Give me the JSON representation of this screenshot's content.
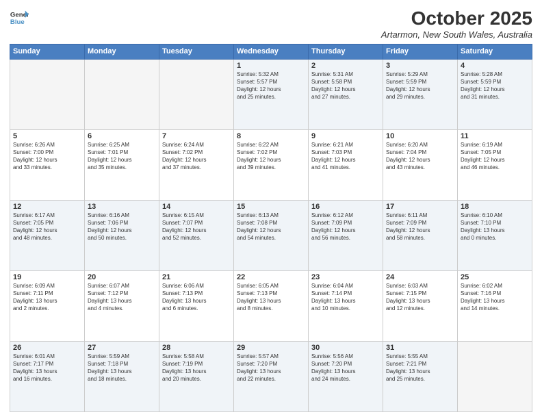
{
  "logo": {
    "line1": "General",
    "line2": "Blue"
  },
  "title": "October 2025",
  "location": "Artarmon, New South Wales, Australia",
  "days_of_week": [
    "Sunday",
    "Monday",
    "Tuesday",
    "Wednesday",
    "Thursday",
    "Friday",
    "Saturday"
  ],
  "weeks": [
    [
      {
        "day": "",
        "info": ""
      },
      {
        "day": "",
        "info": ""
      },
      {
        "day": "",
        "info": ""
      },
      {
        "day": "1",
        "info": "Sunrise: 5:32 AM\nSunset: 5:57 PM\nDaylight: 12 hours\nand 25 minutes."
      },
      {
        "day": "2",
        "info": "Sunrise: 5:31 AM\nSunset: 5:58 PM\nDaylight: 12 hours\nand 27 minutes."
      },
      {
        "day": "3",
        "info": "Sunrise: 5:29 AM\nSunset: 5:59 PM\nDaylight: 12 hours\nand 29 minutes."
      },
      {
        "day": "4",
        "info": "Sunrise: 5:28 AM\nSunset: 5:59 PM\nDaylight: 12 hours\nand 31 minutes."
      }
    ],
    [
      {
        "day": "5",
        "info": "Sunrise: 6:26 AM\nSunset: 7:00 PM\nDaylight: 12 hours\nand 33 minutes."
      },
      {
        "day": "6",
        "info": "Sunrise: 6:25 AM\nSunset: 7:01 PM\nDaylight: 12 hours\nand 35 minutes."
      },
      {
        "day": "7",
        "info": "Sunrise: 6:24 AM\nSunset: 7:02 PM\nDaylight: 12 hours\nand 37 minutes."
      },
      {
        "day": "8",
        "info": "Sunrise: 6:22 AM\nSunset: 7:02 PM\nDaylight: 12 hours\nand 39 minutes."
      },
      {
        "day": "9",
        "info": "Sunrise: 6:21 AM\nSunset: 7:03 PM\nDaylight: 12 hours\nand 41 minutes."
      },
      {
        "day": "10",
        "info": "Sunrise: 6:20 AM\nSunset: 7:04 PM\nDaylight: 12 hours\nand 43 minutes."
      },
      {
        "day": "11",
        "info": "Sunrise: 6:19 AM\nSunset: 7:05 PM\nDaylight: 12 hours\nand 46 minutes."
      }
    ],
    [
      {
        "day": "12",
        "info": "Sunrise: 6:17 AM\nSunset: 7:05 PM\nDaylight: 12 hours\nand 48 minutes."
      },
      {
        "day": "13",
        "info": "Sunrise: 6:16 AM\nSunset: 7:06 PM\nDaylight: 12 hours\nand 50 minutes."
      },
      {
        "day": "14",
        "info": "Sunrise: 6:15 AM\nSunset: 7:07 PM\nDaylight: 12 hours\nand 52 minutes."
      },
      {
        "day": "15",
        "info": "Sunrise: 6:13 AM\nSunset: 7:08 PM\nDaylight: 12 hours\nand 54 minutes."
      },
      {
        "day": "16",
        "info": "Sunrise: 6:12 AM\nSunset: 7:09 PM\nDaylight: 12 hours\nand 56 minutes."
      },
      {
        "day": "17",
        "info": "Sunrise: 6:11 AM\nSunset: 7:09 PM\nDaylight: 12 hours\nand 58 minutes."
      },
      {
        "day": "18",
        "info": "Sunrise: 6:10 AM\nSunset: 7:10 PM\nDaylight: 13 hours\nand 0 minutes."
      }
    ],
    [
      {
        "day": "19",
        "info": "Sunrise: 6:09 AM\nSunset: 7:11 PM\nDaylight: 13 hours\nand 2 minutes."
      },
      {
        "day": "20",
        "info": "Sunrise: 6:07 AM\nSunset: 7:12 PM\nDaylight: 13 hours\nand 4 minutes."
      },
      {
        "day": "21",
        "info": "Sunrise: 6:06 AM\nSunset: 7:13 PM\nDaylight: 13 hours\nand 6 minutes."
      },
      {
        "day": "22",
        "info": "Sunrise: 6:05 AM\nSunset: 7:13 PM\nDaylight: 13 hours\nand 8 minutes."
      },
      {
        "day": "23",
        "info": "Sunrise: 6:04 AM\nSunset: 7:14 PM\nDaylight: 13 hours\nand 10 minutes."
      },
      {
        "day": "24",
        "info": "Sunrise: 6:03 AM\nSunset: 7:15 PM\nDaylight: 13 hours\nand 12 minutes."
      },
      {
        "day": "25",
        "info": "Sunrise: 6:02 AM\nSunset: 7:16 PM\nDaylight: 13 hours\nand 14 minutes."
      }
    ],
    [
      {
        "day": "26",
        "info": "Sunrise: 6:01 AM\nSunset: 7:17 PM\nDaylight: 13 hours\nand 16 minutes."
      },
      {
        "day": "27",
        "info": "Sunrise: 5:59 AM\nSunset: 7:18 PM\nDaylight: 13 hours\nand 18 minutes."
      },
      {
        "day": "28",
        "info": "Sunrise: 5:58 AM\nSunset: 7:19 PM\nDaylight: 13 hours\nand 20 minutes."
      },
      {
        "day": "29",
        "info": "Sunrise: 5:57 AM\nSunset: 7:20 PM\nDaylight: 13 hours\nand 22 minutes."
      },
      {
        "day": "30",
        "info": "Sunrise: 5:56 AM\nSunset: 7:20 PM\nDaylight: 13 hours\nand 24 minutes."
      },
      {
        "day": "31",
        "info": "Sunrise: 5:55 AM\nSunset: 7:21 PM\nDaylight: 13 hours\nand 25 minutes."
      },
      {
        "day": "",
        "info": ""
      }
    ]
  ]
}
